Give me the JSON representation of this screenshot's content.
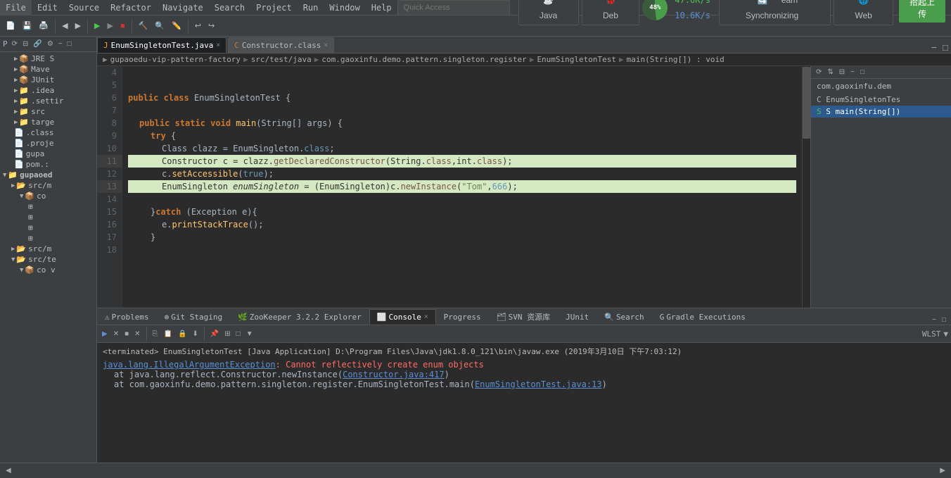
{
  "menubar": {
    "items": [
      "File",
      "Edit",
      "Source",
      "Refactor",
      "Navigate",
      "Search",
      "Project",
      "Run",
      "Window",
      "Help"
    ]
  },
  "toolbar": {
    "quick_access_placeholder": "Quick Access",
    "java_label": "Java",
    "debug_label": "Deb",
    "cpu_percent": "48%",
    "speed_up": "47.6K/s",
    "speed_down": "10.6K/s",
    "sync_label": "eam Synchronizing",
    "web_label": "Web",
    "upload_label": "拾起上传"
  },
  "tabs": [
    {
      "label": "EnumSingletonTest.java",
      "icon": "java",
      "active": true
    },
    {
      "label": "Constructor.class",
      "icon": "class",
      "active": false
    }
  ],
  "breadcrumb": {
    "parts": [
      "gupaoedu-vip-pattern-factory",
      "src/test/java",
      "com.gaoxinfu.demo.pattern.singleton.register",
      "EnumSingletonTest",
      "main(String[]) : void"
    ]
  },
  "code": {
    "lines": [
      {
        "num": 4,
        "text": "",
        "highlighted": false
      },
      {
        "num": 5,
        "text": "",
        "highlighted": false
      },
      {
        "num": 6,
        "text": "public class EnumSingletonTest {",
        "highlighted": false
      },
      {
        "num": 7,
        "text": "",
        "highlighted": false
      },
      {
        "num": 8,
        "text": "    public static void main(String[] args) {",
        "highlighted": false
      },
      {
        "num": 9,
        "text": "        try {",
        "highlighted": false
      },
      {
        "num": 10,
        "text": "            Class clazz = EnumSingleton.class;",
        "highlighted": false
      },
      {
        "num": 11,
        "text": "            Constructor c = clazz.getDeclaredConstructor(String.class,int.class);",
        "highlighted": true
      },
      {
        "num": 12,
        "text": "            c.setAccessible(true);",
        "highlighted": false
      },
      {
        "num": 13,
        "text": "            EnumSingleton enumSingleton = (EnumSingleton)c.newInstance(\"Tom\",666);",
        "highlighted": true
      },
      {
        "num": 14,
        "text": "",
        "highlighted": false
      },
      {
        "num": 15,
        "text": "        }catch (Exception e){",
        "highlighted": false
      },
      {
        "num": 16,
        "text": "            e.printStackTrace();",
        "highlighted": false
      },
      {
        "num": 17,
        "text": "        }",
        "highlighted": false
      },
      {
        "num": 18,
        "text": "",
        "highlighted": false
      }
    ]
  },
  "console": {
    "terminated_text": "<terminated> EnumSingletonTest [Java Application] D:\\Program Files\\Java\\jdk1.8.0_121\\bin\\javaw.exe (2019年3月10日 下午7:03:12)",
    "error_link": "java.lang.IllegalArgumentException",
    "error_desc": ": Cannot reflectively create enum objects",
    "stack1_prefix": "    at java.lang.reflect.Constructor.newInstance(",
    "stack1_link": "Constructor.java:417",
    "stack1_suffix": ")",
    "stack2_prefix": "    at com.gaoxinfu.demo.pattern.singleton.register.EnumSingletonTest.main(",
    "stack2_link": "EnumSingletonTest.java:13",
    "stack2_suffix": ")"
  },
  "bottom_tabs": [
    {
      "label": "Problems",
      "active": false
    },
    {
      "label": "Git Staging",
      "active": false
    },
    {
      "label": "ZooKeeper 3.2.2 Explorer",
      "active": false
    },
    {
      "label": "Console",
      "active": true
    },
    {
      "label": "Progress",
      "active": false
    },
    {
      "label": "SVN 资源库",
      "active": false
    },
    {
      "label": "JUnit",
      "active": false
    },
    {
      "label": "Search",
      "active": false
    },
    {
      "label": "Gradle Executions",
      "active": false
    }
  ],
  "outline": {
    "title": "com.gaoxinfu.dem",
    "items": [
      {
        "label": "EnumSingletonTes",
        "selected": false
      },
      {
        "label": "S main(String[])",
        "selected": true
      }
    ]
  },
  "sidebar": {
    "items": [
      {
        "label": "JRE S",
        "indent": 1,
        "expanded": false
      },
      {
        "label": "Mave",
        "indent": 1,
        "expanded": false
      },
      {
        "label": "JUnit",
        "indent": 1,
        "expanded": false
      },
      {
        "label": ".idea",
        "indent": 1,
        "expanded": false
      },
      {
        "label": ".settir",
        "indent": 1,
        "expanded": false
      },
      {
        "label": "src",
        "indent": 1,
        "expanded": false
      },
      {
        "label": "targe",
        "indent": 1,
        "expanded": false
      },
      {
        "label": ".class",
        "indent": 1,
        "expanded": false
      },
      {
        "label": ".proje",
        "indent": 1,
        "expanded": false
      },
      {
        "label": "gupa",
        "indent": 1,
        "expanded": false
      },
      {
        "label": "pom.:",
        "indent": 1,
        "expanded": false
      },
      {
        "label": "gupaoed",
        "indent": 0,
        "expanded": true
      },
      {
        "label": "src/m",
        "indent": 1,
        "expanded": false
      },
      {
        "label": "co",
        "indent": 2,
        "expanded": true
      },
      {
        "label": "",
        "indent": 3,
        "expanded": false
      },
      {
        "label": "",
        "indent": 3,
        "expanded": false
      },
      {
        "label": "",
        "indent": 3,
        "expanded": false
      },
      {
        "label": "",
        "indent": 3,
        "expanded": false
      },
      {
        "label": "src/m",
        "indent": 1,
        "expanded": false
      },
      {
        "label": "src/te",
        "indent": 1,
        "expanded": true
      },
      {
        "label": "co v",
        "indent": 2,
        "expanded": true
      }
    ]
  }
}
